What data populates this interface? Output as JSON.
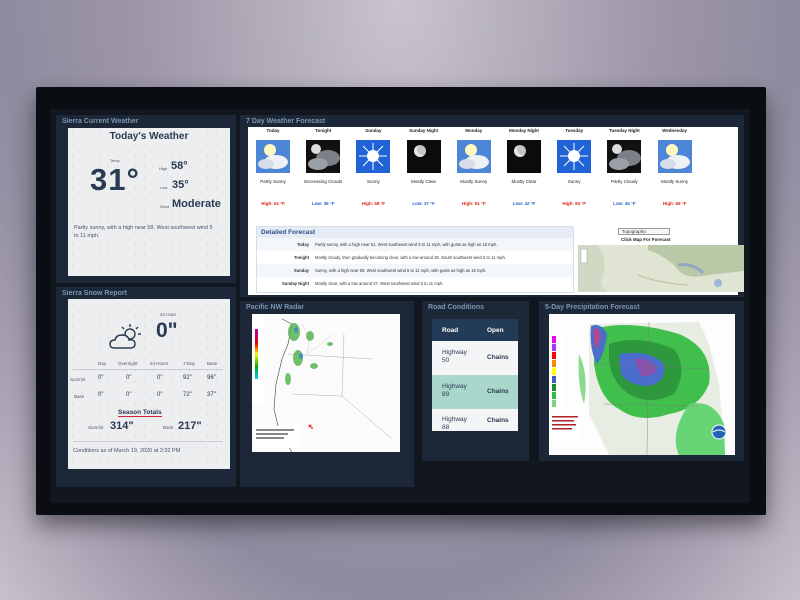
{
  "panels": {
    "current_weather": "Sierra Current Weather",
    "forecast": "7 Day Weather Forecast",
    "snow_report": "Sierra Snow Report",
    "radar": "Pacific NW Radar",
    "road": "Road Conditions",
    "precip": "5-Day Precipitation Forecast"
  },
  "today": {
    "title": "Today's Weather",
    "temp_label": "Temp",
    "temp": "31°",
    "high_label": "High",
    "high": "58°",
    "low_label": "Low",
    "low": "35°",
    "wind_label": "Wind",
    "wind": "Moderate",
    "description": "Partly sunny, with a high near 58. West southwest wind 5 to 11 mph."
  },
  "snow": {
    "hours_label": "24 Hour",
    "hours_value": "0\"",
    "headers": [
      "Day",
      "Overnight",
      "24 Hours",
      "7-Day",
      "Base"
    ],
    "rows": [
      {
        "label": "Summit",
        "values": [
          "0\"",
          "0\"",
          "0\"",
          "92\"",
          "96\""
        ]
      },
      {
        "label": "Base",
        "values": [
          "0\"",
          "0\"",
          "0\"",
          "72\"",
          "37\""
        ]
      }
    ],
    "season_title": "Season Totals",
    "summit_label": "Summit",
    "summit_value": "314\"",
    "base_label": "Base",
    "base_value": "217\"",
    "conditions": "Conditions as of March 19, 2020 at 2:32 PM"
  },
  "forecast": {
    "days": [
      {
        "name": "Today",
        "desc": "Partly Sunny",
        "temp": "High: 61 °F",
        "kind": "high",
        "icon": "partly-sunny-icon"
      },
      {
        "name": "Tonight",
        "desc": "Decreasing Clouds",
        "temp": "Low: 36 °F",
        "kind": "low",
        "icon": "night-cloudy-icon"
      },
      {
        "name": "Sunday",
        "desc": "Sunny",
        "temp": "High: 58 °F",
        "kind": "high",
        "icon": "sunny-icon"
      },
      {
        "name": "Sunday Night",
        "desc": "Mostly Clear",
        "temp": "Low: 37 °F",
        "kind": "low",
        "icon": "moon-icon"
      },
      {
        "name": "Monday",
        "desc": "Mostly Sunny",
        "temp": "High: 51 °F",
        "kind": "high",
        "icon": "partly-sunny-icon"
      },
      {
        "name": "Monday Night",
        "desc": "Mostly Clear",
        "temp": "Low: 42 °F",
        "kind": "low",
        "icon": "moon-icon"
      },
      {
        "name": "Tuesday",
        "desc": "Sunny",
        "temp": "High: 60 °F",
        "kind": "high",
        "icon": "sunny-icon"
      },
      {
        "name": "Tuesday Night",
        "desc": "Partly Cloudy",
        "temp": "Low: 45 °F",
        "kind": "low",
        "icon": "night-cloudy-icon"
      },
      {
        "name": "Wednesday",
        "desc": "Mostly Sunny",
        "temp": "High: 65 °F",
        "kind": "high",
        "icon": "partly-sunny-icon"
      }
    ],
    "detailed_title": "Detailed Forecast",
    "detailed": [
      {
        "day": "Today",
        "text": "Partly sunny, with a high near 61. West southwest wind 5 to 11 mph, with gusts as high as 18 mph."
      },
      {
        "day": "Tonight",
        "text": "Mostly cloudy, then gradually becoming clear, with a low around 39. South southwest wind 5 to 11 mph."
      },
      {
        "day": "Sunday",
        "text": "Sunny, with a high near 58. West southwest wind 5 to 11 mph, with gusts as high as 18 mph."
      },
      {
        "day": "Sunday Night",
        "text": "Mostly clear, with a low around 37. West southwest wind 5 to 11 mph."
      }
    ],
    "map_select": "Topographic",
    "map_caption": "Click Map For Forecast"
  },
  "road": {
    "col_road": "Road",
    "col_open": "Open",
    "rows": [
      {
        "road": "Highway 50",
        "status": "Chains"
      },
      {
        "road": "Highway 89",
        "status": "Chains"
      },
      {
        "road": "Highway 88",
        "status": "Chains"
      }
    ]
  },
  "colors": {
    "panel_bg": "#1c2838",
    "header_blue": "#243b58",
    "high_red": "#dd2211",
    "low_blue": "#2260c8",
    "road_highlight": "#a9d7cc"
  }
}
